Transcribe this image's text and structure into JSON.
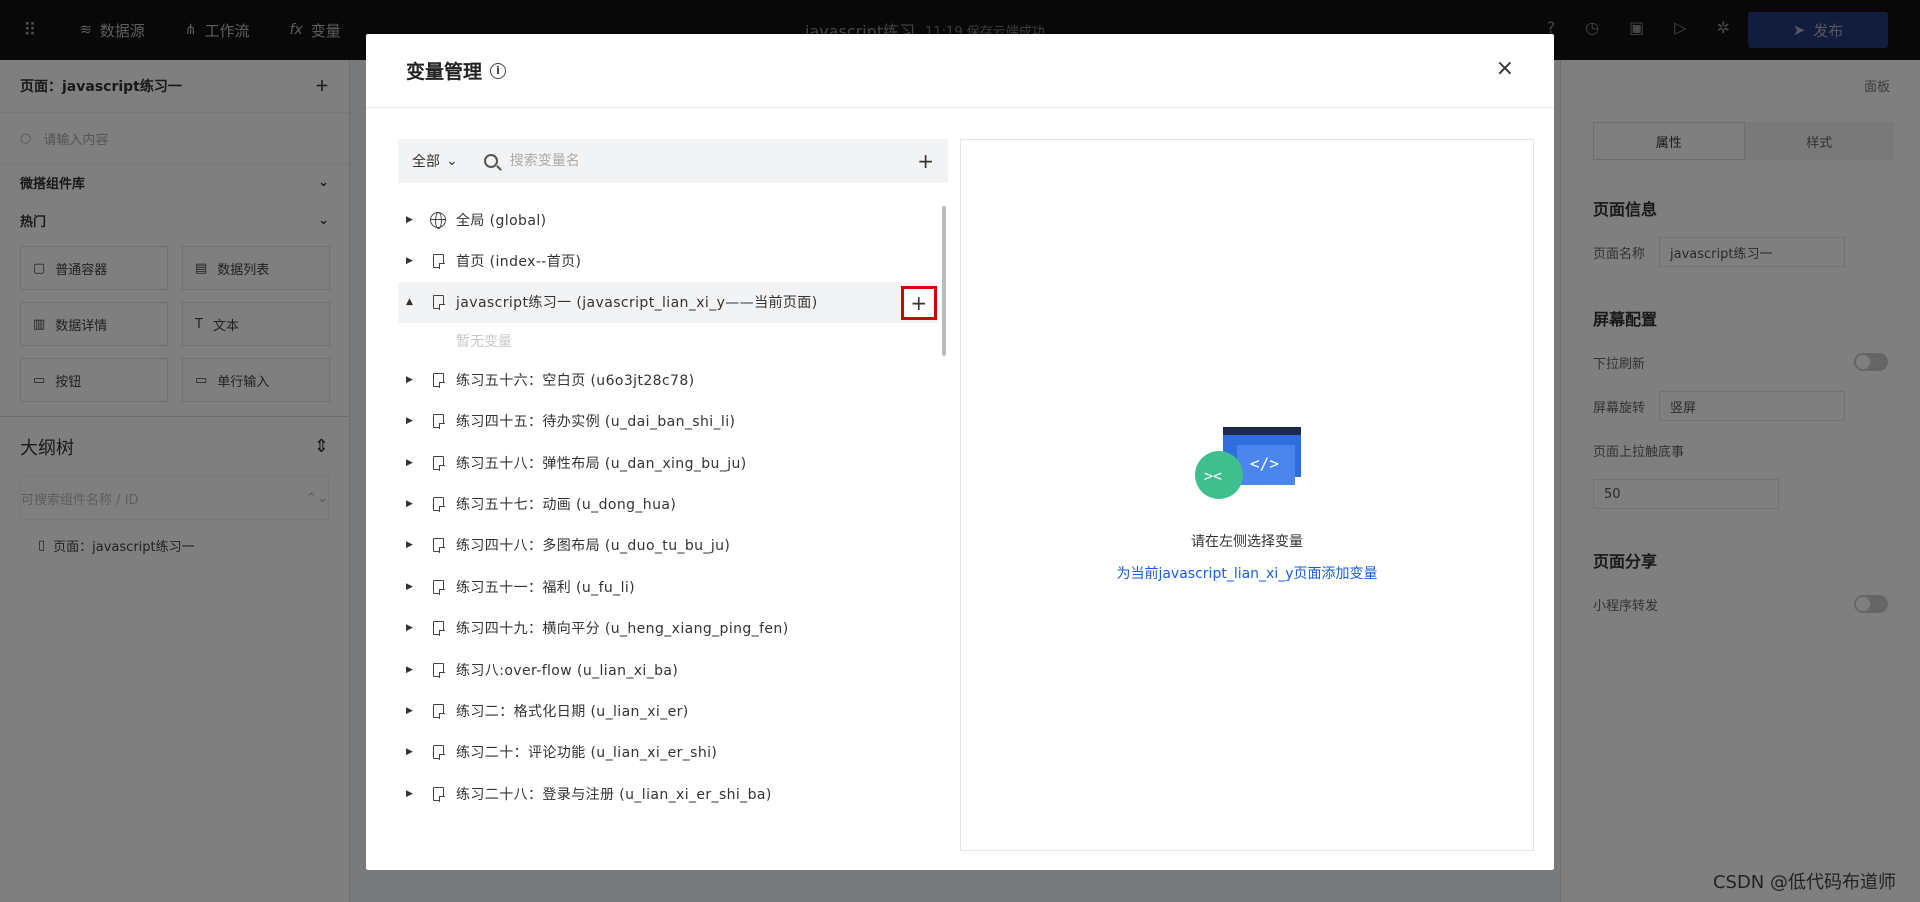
{
  "topbar": {
    "nav": [
      {
        "icon": "database-icon",
        "label": "数据源"
      },
      {
        "icon": "workflow-icon",
        "label": "工作流"
      },
      {
        "icon": "fx-icon",
        "label": "变量"
      }
    ],
    "doc_title": "javascript练习",
    "save_status": "11:19 保存云端成功",
    "publish_label": "发布"
  },
  "left_panel": {
    "page_label": "页面：javascript练习一",
    "search_placeholder": "请输入内容",
    "library_title": "微搭组件库",
    "hot_title": "热门",
    "components": [
      "普通容器",
      "数据列表",
      "数据详情",
      "文本",
      "按钮",
      "单行输入"
    ],
    "outline_title": "大纲树",
    "outline_search_placeholder": "可搜索组件名称 / ID",
    "outline_item": "页面：javascript练习一"
  },
  "right_panel": {
    "panel_label": "面板",
    "tabs": [
      "属性",
      "样式"
    ],
    "page_info_title": "页面信息",
    "page_name_label": "页面名称",
    "page_name_value": "javascript练习一",
    "screen_title": "屏幕配置",
    "pull_refresh_label": "下拉刷新",
    "rotation_label": "屏幕旋转",
    "rotation_value": "竖屏",
    "reach_bottom_label": "页面上拉触底事",
    "reach_bottom_value": "50",
    "share_title": "页面分享",
    "share_label": "小程序转发"
  },
  "modal": {
    "title": "变量管理",
    "filter_label": "全部",
    "search_placeholder": "搜索变量名",
    "tree": [
      {
        "type": "global",
        "label": "全局 (global)",
        "expanded": false
      },
      {
        "type": "page",
        "label": "首页 (index--首页)",
        "expanded": false
      },
      {
        "type": "page",
        "label": "javascript练习一 (javascript_lian_xi_y——当前页面)",
        "expanded": true,
        "selected": true
      },
      {
        "type": "page",
        "label": "练习五十六：空白页 (u6o3jt28c78)",
        "expanded": false
      },
      {
        "type": "page",
        "label": "练习四十五：待办实例 (u_dai_ban_shi_li)",
        "expanded": false
      },
      {
        "type": "page",
        "label": "练习五十八：弹性布局 (u_dan_xing_bu_ju)",
        "expanded": false
      },
      {
        "type": "page",
        "label": "练习五十七：动画 (u_dong_hua)",
        "expanded": false
      },
      {
        "type": "page",
        "label": "练习四十八：多图布局 (u_duo_tu_bu_ju)",
        "expanded": false
      },
      {
        "type": "page",
        "label": "练习五十一：福利 (u_fu_li)",
        "expanded": false
      },
      {
        "type": "page",
        "label": "练习四十九：横向平分 (u_heng_xiang_ping_fen)",
        "expanded": false
      },
      {
        "type": "page",
        "label": "练习八:over-flow (u_lian_xi_ba)",
        "expanded": false
      },
      {
        "type": "page",
        "label": "练习二：格式化日期 (u_lian_xi_er)",
        "expanded": false
      },
      {
        "type": "page",
        "label": "练习二十：评论功能 (u_lian_xi_er_shi)",
        "expanded": false
      },
      {
        "type": "page",
        "label": "练习二十八：登录与注册 (u_lian_xi_er_shi_ba)",
        "expanded": false
      }
    ],
    "empty_vars": "暂无变量",
    "empty_tip": "请在左侧选择变量",
    "empty_link": "为当前javascript_lian_xi_y页面添加变量"
  },
  "watermark": "CSDN @低代码布道师",
  "colors": {
    "accent": "#1a5de0",
    "highlight_border": "#d40000"
  }
}
